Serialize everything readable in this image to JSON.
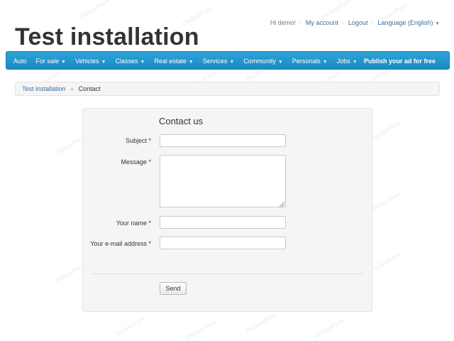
{
  "header": {
    "site_title": "Test installation",
    "greeting": "Hi demo!",
    "my_account": "My account",
    "logout": "Logout",
    "language": "Language (English)",
    "separator": "·"
  },
  "nav": {
    "items": [
      {
        "label": "Auto",
        "dropdown": false
      },
      {
        "label": "For sale",
        "dropdown": true
      },
      {
        "label": "Vehicles",
        "dropdown": true
      },
      {
        "label": "Classes",
        "dropdown": true
      },
      {
        "label": "Real estate",
        "dropdown": true
      },
      {
        "label": "Services",
        "dropdown": true
      },
      {
        "label": "Community",
        "dropdown": true
      },
      {
        "label": "Personals",
        "dropdown": true
      },
      {
        "label": "Jobs",
        "dropdown": true
      }
    ],
    "publish": "Publish your ad for free",
    "caret_icon": "chevron-down-icon"
  },
  "breadcrumb": {
    "home": "Test installation",
    "separator": "»",
    "current": "Contact"
  },
  "form": {
    "title": "Contact us",
    "subject_label": "Subject *",
    "subject_value": "",
    "message_label": "Message *",
    "message_value": "",
    "name_label": "Your name *",
    "name_value": "",
    "email_label": "Your e-mail address *",
    "email_value": "",
    "send_label": "Send"
  },
  "watermark_text": "OsclassPoint",
  "colors": {
    "nav_bg": "#1b8ac2",
    "link": "#3a6fa0",
    "panel_bg": "#f5f5f5"
  }
}
